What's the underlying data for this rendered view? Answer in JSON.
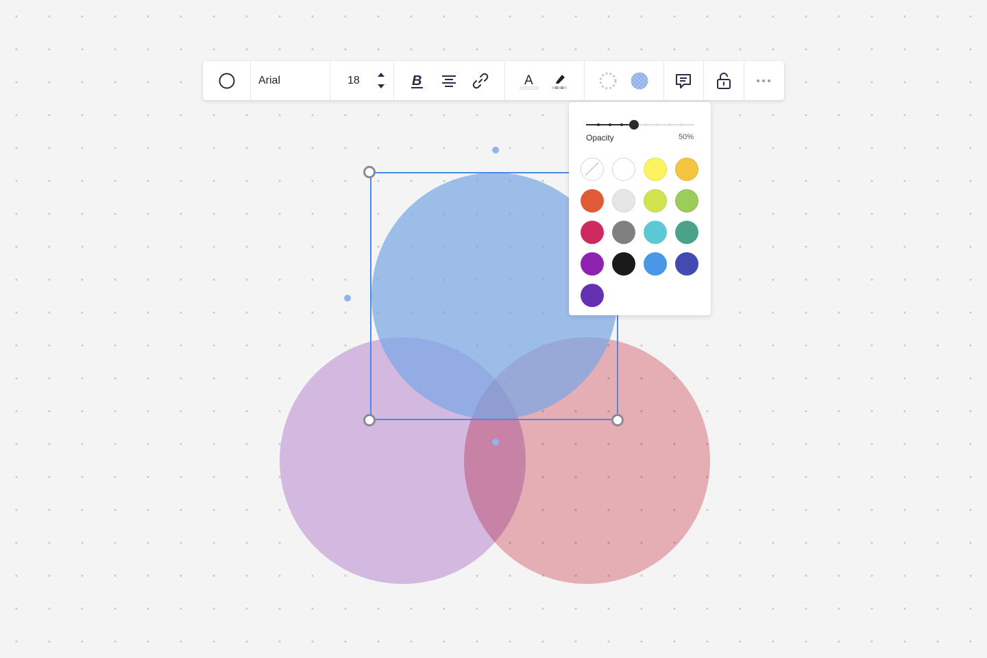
{
  "toolbar": {
    "shape": "circle-icon",
    "font_family": "Arial",
    "font_size": "18",
    "icons": [
      "circle-icon",
      "chevron-up-icon",
      "chevron-down-icon",
      "bold-icon",
      "align-center-icon",
      "link-icon",
      "text-color-icon",
      "highlighter-icon",
      "border-style-icon",
      "fill-color-icon",
      "comment-icon",
      "lock-open-icon",
      "more-icon"
    ]
  },
  "color_popover": {
    "opacity_label": "Opacity",
    "opacity_value": "50%",
    "opacity_level": 0.5,
    "swatches": [
      {
        "name": "none",
        "color": "transparent"
      },
      {
        "name": "white",
        "color": "#ffffff"
      },
      {
        "name": "yellow",
        "color": "#fbf35f"
      },
      {
        "name": "amber",
        "color": "#f3c540"
      },
      {
        "name": "orange-red",
        "color": "#e05a36"
      },
      {
        "name": "light-gray",
        "color": "#e6e6e6"
      },
      {
        "name": "lime",
        "color": "#d1e44f"
      },
      {
        "name": "green",
        "color": "#9ccd5b"
      },
      {
        "name": "crimson",
        "color": "#cf2a60"
      },
      {
        "name": "gray",
        "color": "#808080"
      },
      {
        "name": "cyan",
        "color": "#5cc8d3"
      },
      {
        "name": "teal",
        "color": "#4aa388"
      },
      {
        "name": "purple",
        "color": "#8d23ae"
      },
      {
        "name": "black",
        "color": "#1a1a1a"
      },
      {
        "name": "blue",
        "color": "#4a96e8"
      },
      {
        "name": "indigo",
        "color": "#434bb0"
      },
      {
        "name": "violet",
        "color": "#6530b2"
      }
    ]
  },
  "canvas": {
    "shapes": [
      {
        "name": "blue-circle",
        "color": "#7ba7e4"
      },
      {
        "name": "purple-circle",
        "color": "#d3b8e0"
      },
      {
        "name": "pink-circle",
        "color": "#f0b6bd"
      }
    ],
    "selection_color": "#4a88ec"
  }
}
